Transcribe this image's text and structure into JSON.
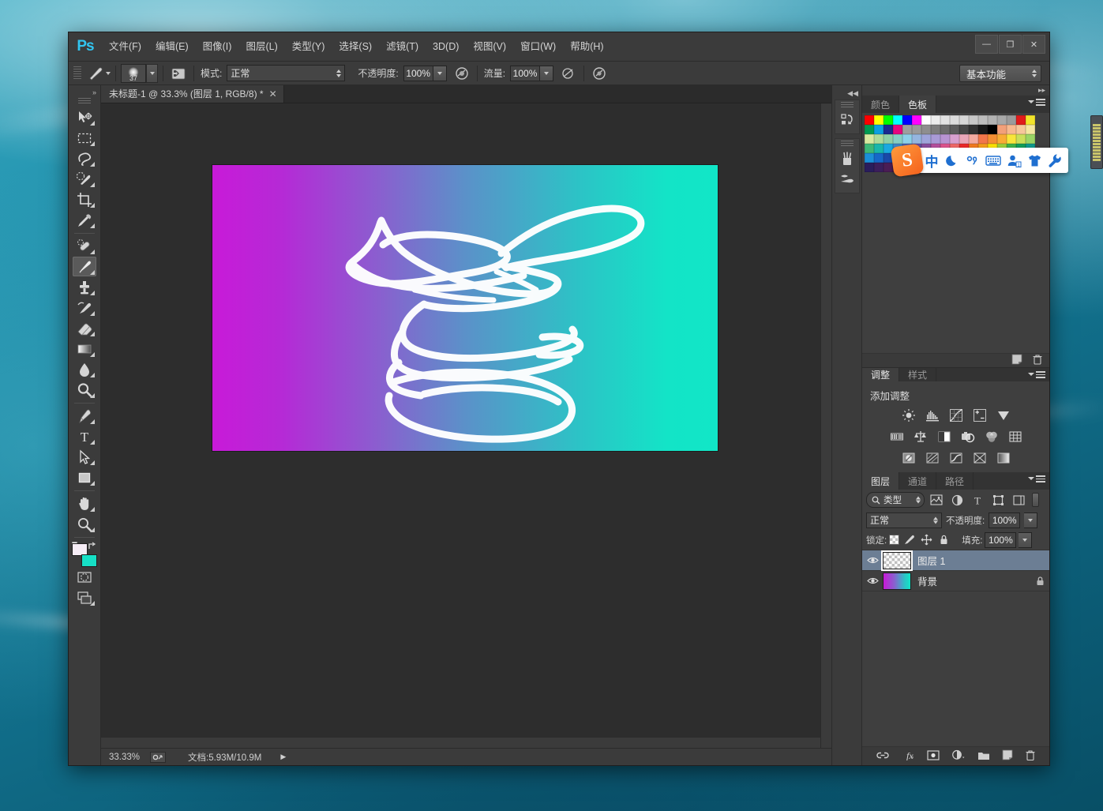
{
  "app": {
    "name": "Photoshop",
    "logo_text": "Ps"
  },
  "window_controls": [
    {
      "name": "minimize",
      "glyph": "—"
    },
    {
      "name": "maximize",
      "glyph": "❐"
    },
    {
      "name": "close",
      "glyph": "✕"
    }
  ],
  "menubar": {
    "items": [
      {
        "label": "文件(F)"
      },
      {
        "label": "编辑(E)"
      },
      {
        "label": "图像(I)"
      },
      {
        "label": "图层(L)"
      },
      {
        "label": "类型(Y)"
      },
      {
        "label": "选择(S)"
      },
      {
        "label": "滤镜(T)"
      },
      {
        "label": "3D(D)"
      },
      {
        "label": "视图(V)"
      },
      {
        "label": "窗口(W)"
      },
      {
        "label": "帮助(H)"
      }
    ]
  },
  "options_bar": {
    "brush_size": "37",
    "mode_label": "模式:",
    "mode_value": "正常",
    "opacity_label": "不透明度:",
    "opacity_value": "100%",
    "flow_label": "流量:",
    "flow_value": "100%",
    "workspace": "基本功能"
  },
  "document": {
    "tab_title": "未标题-1 @ 33.3% (图层 1, RGB/8) *",
    "close_glyph": "✕"
  },
  "status_bar": {
    "zoom": "33.33%",
    "doc_info": "文档:5.93M/10.9M",
    "play_glyph": "▶"
  },
  "canvas": {
    "gradient_from": "#c81ad8",
    "gradient_to": "#11e6c7",
    "stroke_color": "#ffffff"
  },
  "toolbar": {
    "tools": [
      {
        "name": "move-tool",
        "title": "移动工具",
        "active": false
      },
      {
        "name": "marquee-tool",
        "title": "矩形选框工具",
        "active": false
      },
      {
        "name": "lasso-tool",
        "title": "套索工具",
        "active": false
      },
      {
        "name": "quick-selection-tool",
        "title": "快速选择工具",
        "active": false
      },
      {
        "name": "crop-tool",
        "title": "裁剪工具",
        "active": false
      },
      {
        "name": "eyedropper-tool",
        "title": "吸管工具",
        "active": false
      },
      {
        "name": "healing-brush-tool",
        "title": "污点修复画笔工具",
        "active": false
      },
      {
        "name": "brush-tool",
        "title": "画笔工具",
        "active": true
      },
      {
        "name": "clone-stamp-tool",
        "title": "仿制图章工具",
        "active": false
      },
      {
        "name": "history-brush-tool",
        "title": "历史记录画笔工具",
        "active": false
      },
      {
        "name": "eraser-tool",
        "title": "橡皮擦工具",
        "active": false
      },
      {
        "name": "gradient-tool",
        "title": "渐变工具",
        "active": false
      },
      {
        "name": "blur-tool",
        "title": "模糊工具",
        "active": false
      },
      {
        "name": "dodge-tool",
        "title": "减淡工具",
        "active": false
      },
      {
        "name": "pen-tool",
        "title": "钢笔工具",
        "active": false
      },
      {
        "name": "type-tool",
        "title": "横排文字工具",
        "active": false
      },
      {
        "name": "path-selection-tool",
        "title": "路径选择工具",
        "active": false
      },
      {
        "name": "rectangle-tool",
        "title": "矩形工具",
        "active": false
      },
      {
        "name": "hand-tool",
        "title": "抓手工具",
        "active": false
      },
      {
        "name": "zoom-tool",
        "title": "缩放工具",
        "active": false
      }
    ],
    "foreground_color": "#f6edf6",
    "background_color": "#16e0c6",
    "quick_mask_label": "以快速蒙版模式编辑",
    "screen_mode_label": "更改屏幕模式"
  },
  "rail": {
    "icons": [
      {
        "name": "history-panel-icon"
      },
      {
        "name": "brush-panel-icon"
      },
      {
        "name": "brush-presets-panel-icon"
      }
    ]
  },
  "panels": {
    "color": {
      "tabs": [
        {
          "label": "颜色",
          "active": false
        },
        {
          "label": "色板",
          "active": true
        }
      ],
      "swatches": [
        "#ff0000",
        "#ffff00",
        "#00ff00",
        "#00ffff",
        "#0000ff",
        "#ff00ff",
        "#ffffff",
        "#ececec",
        "#e2e2e2",
        "#dcdcdc",
        "#d6d6d6",
        "#c8c8c8",
        "#bdbdbd",
        "#b2b2b2",
        "#a8a8a8",
        "#9b9b9b",
        "#e01b1b",
        "#f2e42b",
        "#009b52",
        "#0b9fe0",
        "#1b2a8f",
        "#e5057f",
        "#9e9e9e",
        "#9a9a9a",
        "#8e8e8e",
        "#7c7c7c",
        "#6c6c6c",
        "#5c5c5c",
        "#474747",
        "#333333",
        "#1a1a1a",
        "#000000",
        "#f2a07a",
        "#f7b98f",
        "#f6c79b",
        "#f4e7a0",
        "#d8e9a0",
        "#aedb9a",
        "#8ed0a6",
        "#85cfc4",
        "#8cd0e8",
        "#95b6e0",
        "#9fa4da",
        "#a99ad6",
        "#b894d2",
        "#d8a0cf",
        "#e9a6b8",
        "#f3aaa0",
        "#f2764a",
        "#f58f33",
        "#f9ad34",
        "#f8e53b",
        "#c9df5a",
        "#9ad565",
        "#3db878",
        "#19b6ab",
        "#1ba9e0",
        "#3f86c9",
        "#4f63b5",
        "#6a4fa6",
        "#8a4fa0",
        "#b8509e",
        "#e0548f",
        "#f26a6a",
        "#ee2a2a",
        "#f47b20",
        "#f9a11b",
        "#ffe400",
        "#9fd23a",
        "#3fb54a",
        "#12a05a",
        "#0f9b8e",
        "#1b8fd8",
        "#1668c8",
        "#1a49a8",
        "#2d2f92",
        "#4a2d8e",
        "#6a2d8e",
        "#8e2d82",
        "#b02a70",
        "#c92a5c",
        "#d8284a",
        "#a82020",
        "#8c1b1b",
        "#c98b3c",
        "#d6a24f",
        "#b88a3a",
        "#f5d48a",
        "#ffdf9a",
        "#f0c36a",
        "#2a1d5c",
        "#3b1e5c",
        "#4a1d55",
        "#5c1b4a",
        "#6e1b40",
        "#7c1b33",
        "#8a1b28",
        "#3a2a12",
        "#2e2a14",
        "#241f14",
        "#1c1a12",
        "#4a3a1c",
        "#6a5226",
        "#7c6130",
        "#8e6f36",
        "#a07c3d",
        "#b08a44",
        "#8a6a32"
      ],
      "footer_icons": [
        {
          "name": "new-swatch-icon"
        },
        {
          "name": "delete-swatch-icon"
        }
      ]
    },
    "adjustments": {
      "tabs": [
        {
          "label": "调整",
          "active": true
        },
        {
          "label": "样式",
          "active": false
        }
      ],
      "title": "添加调整",
      "icons": [
        {
          "name": "brightness-contrast-icon"
        },
        {
          "name": "levels-icon"
        },
        {
          "name": "curves-icon"
        },
        {
          "name": "exposure-icon"
        },
        {
          "name": "vibrance-icon"
        },
        {
          "name": "hue-saturation-icon"
        },
        {
          "name": "color-balance-icon"
        },
        {
          "name": "black-white-icon"
        },
        {
          "name": "photo-filter-icon"
        },
        {
          "name": "channel-mixer-icon"
        },
        {
          "name": "color-lookup-icon"
        },
        {
          "name": "invert-icon"
        },
        {
          "name": "posterize-icon"
        },
        {
          "name": "threshold-icon"
        },
        {
          "name": "selective-color-icon"
        },
        {
          "name": "gradient-map-icon"
        }
      ]
    },
    "layers": {
      "tabs": [
        {
          "label": "图层",
          "active": true
        },
        {
          "label": "通道",
          "active": false
        },
        {
          "label": "路径",
          "active": false
        }
      ],
      "filter_label": "类型",
      "filter_icons": [
        {
          "name": "filter-pixel-icon"
        },
        {
          "name": "filter-adjustment-icon"
        },
        {
          "name": "filter-type-icon"
        },
        {
          "name": "filter-shape-icon"
        },
        {
          "name": "filter-smart-object-icon"
        }
      ],
      "blend_mode": "正常",
      "opacity_label": "不透明度:",
      "opacity_value": "100%",
      "lock_label": "锁定:",
      "lock_icons": [
        {
          "name": "lock-transparent-pixels-icon"
        },
        {
          "name": "lock-image-pixels-icon"
        },
        {
          "name": "lock-position-icon"
        },
        {
          "name": "lock-all-icon"
        }
      ],
      "fill_label": "填充:",
      "fill_value": "100%",
      "items": [
        {
          "name": "图层 1",
          "selected": true,
          "locked": false,
          "thumb": "checker",
          "visible": true
        },
        {
          "name": "背景",
          "selected": false,
          "locked": true,
          "thumb": "gradient",
          "visible": true
        }
      ],
      "footer_icons": [
        {
          "name": "link-layers-icon"
        },
        {
          "name": "layer-style-icon"
        },
        {
          "name": "layer-mask-icon"
        },
        {
          "name": "new-adjustment-layer-icon"
        },
        {
          "name": "new-group-icon"
        },
        {
          "name": "new-layer-icon"
        },
        {
          "name": "delete-layer-icon"
        }
      ]
    }
  },
  "sogou_ime": {
    "logo": "S",
    "buttons": [
      {
        "name": "input-mode-chinese",
        "label": "中"
      },
      {
        "name": "night-mode-icon",
        "label": "moon"
      },
      {
        "name": "punctuation-mode-icon",
        "label": "punct"
      },
      {
        "name": "soft-keyboard-icon",
        "label": "keyboard"
      },
      {
        "name": "user-login-icon",
        "label": "user"
      },
      {
        "name": "skin-icon",
        "label": "shirt"
      },
      {
        "name": "toolbox-icon",
        "label": "wrench"
      }
    ]
  }
}
